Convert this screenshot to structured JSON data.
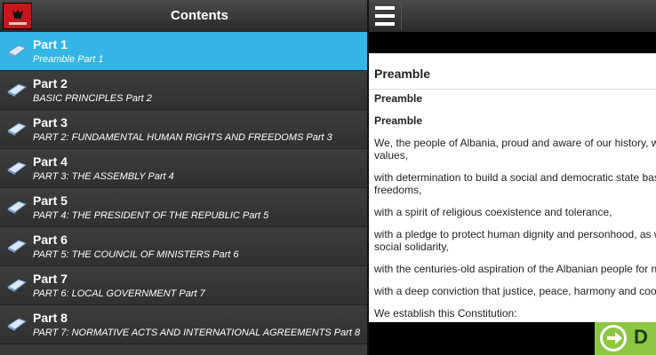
{
  "header": {
    "title": "Contents"
  },
  "sidebar": {
    "items": [
      {
        "title": "Part 1",
        "subtitle": "Preamble Part 1",
        "selected": true
      },
      {
        "title": "Part 2",
        "subtitle": "BASIC PRINCIPLES Part 2"
      },
      {
        "title": "Part 3",
        "subtitle": "PART 2: FUNDAMENTAL HUMAN RIGHTS AND FREEDOMS Part 3"
      },
      {
        "title": "Part 4",
        "subtitle": "PART 3: THE ASSEMBLY Part 4"
      },
      {
        "title": "Part 5",
        "subtitle": "PART 4: THE PRESIDENT OF THE REPUBLIC Part 5"
      },
      {
        "title": "Part 6",
        "subtitle": "PART 5: THE COUNCIL OF MINISTERS Part 6"
      },
      {
        "title": "Part 7",
        "subtitle": "PART 6: LOCAL GOVERNMENT Part 7"
      },
      {
        "title": "Part 8",
        "subtitle": "PART 7: NORMATIVE ACTS AND INTERNATIONAL AGREEMENTS Part 8"
      }
    ]
  },
  "document": {
    "heading": "Preamble",
    "sub1": "Preamble",
    "sub2": "Preamble",
    "paragraphs": [
      "We, the people of Albania, proud and aware of our history, wit values,",
      "with determination to build a social and democratic state base freedoms,",
      "with a spirit of religious coexistence and tolerance,",
      "with a pledge to protect human dignity and personhood, as we social solidarity,",
      "with the centuries-old aspiration of the Albanian people for na",
      "with a deep conviction that justice, peace, harmony and coope",
      "We establish this Constitution:"
    ]
  },
  "footer": {
    "button_label": "D"
  },
  "colors": {
    "selected": "#33b5e5",
    "accent_green": "#8dc641",
    "flag_red": "#c8161d"
  },
  "icons": {
    "app": "albania-flag-icon",
    "menu": "hamburger-menu-icon",
    "item": "book-icon",
    "next": "arrow-right-circle-icon"
  }
}
